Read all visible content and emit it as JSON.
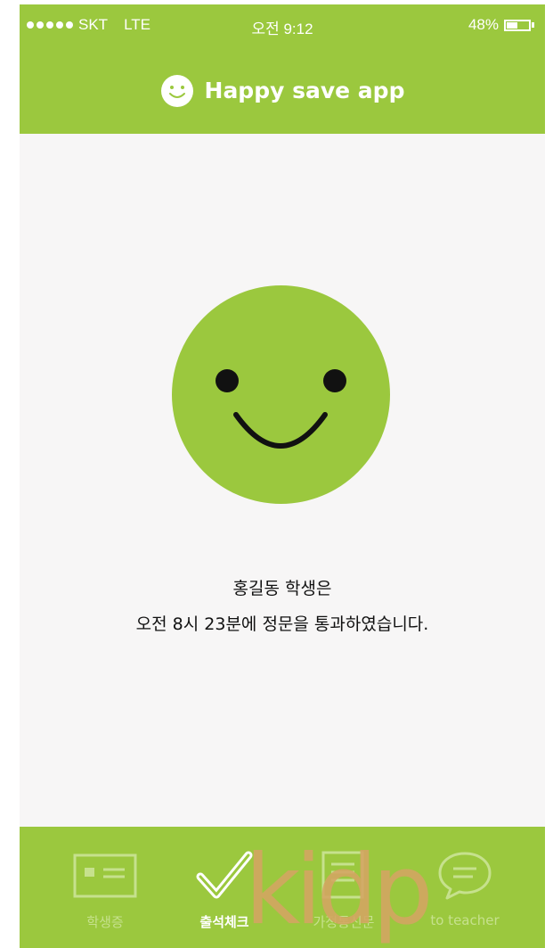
{
  "status_bar": {
    "carrier": "SKT",
    "network": "LTE",
    "time": "오전 9:12",
    "battery_text": "48%",
    "battery_level": 0.48
  },
  "app": {
    "title": "Happy save app",
    "brand_color": "#9bc83e"
  },
  "message": {
    "line1": "홍길동 학생은",
    "line2": "오전 8시 23분에 정문을 통과하였습니다."
  },
  "tabs": [
    {
      "label": "학생증",
      "icon": "id-card-icon",
      "active": false
    },
    {
      "label": "출석체크",
      "icon": "checkmark-icon",
      "active": true
    },
    {
      "label": "가정통신문",
      "icon": "notice-document-icon",
      "active": false
    },
    {
      "label": "to teacher",
      "icon": "chat-bubble-icon",
      "active": false
    }
  ],
  "watermark": {
    "text": "kidp",
    "color": "#d4a463"
  }
}
